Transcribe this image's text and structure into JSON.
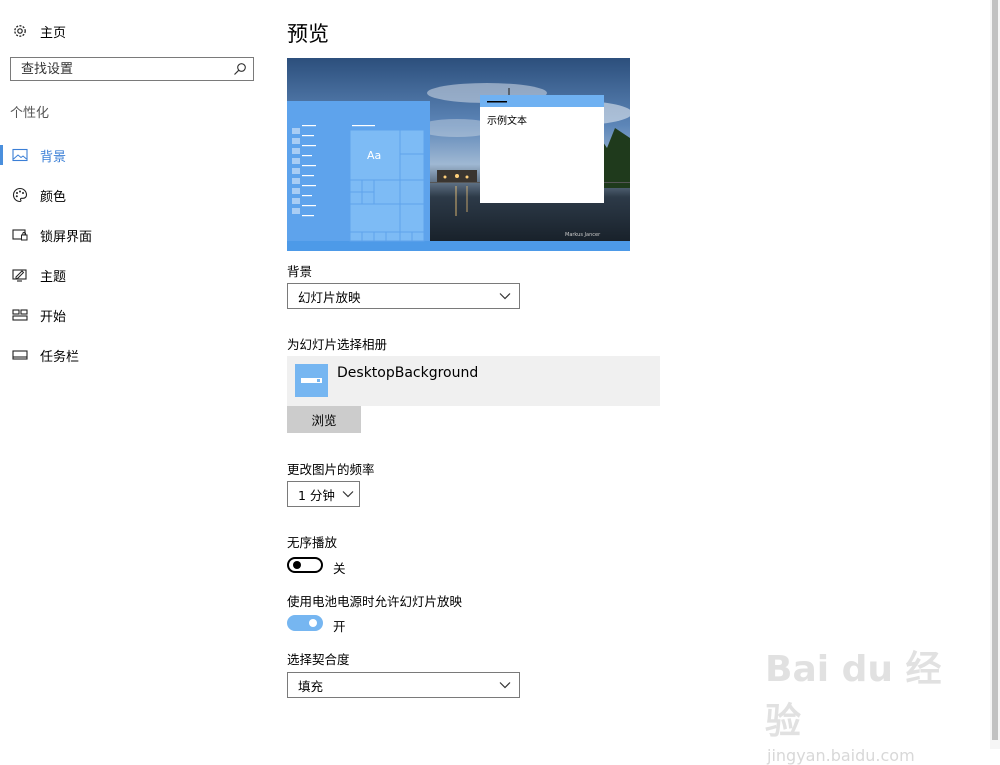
{
  "sidebar": {
    "home_label": "主页",
    "search_placeholder": "查找设置",
    "section_title": "个性化",
    "items": [
      {
        "label": "背景",
        "icon": "picture-icon",
        "selected": true
      },
      {
        "label": "颜色",
        "icon": "palette-icon",
        "selected": false
      },
      {
        "label": "锁屏界面",
        "icon": "lock-screen-icon",
        "selected": false
      },
      {
        "label": "主题",
        "icon": "theme-icon",
        "selected": false
      },
      {
        "label": "开始",
        "icon": "start-icon",
        "selected": false
      },
      {
        "label": "任务栏",
        "icon": "taskbar-icon",
        "selected": false
      }
    ]
  },
  "main": {
    "title": "预览",
    "preview": {
      "sample_text": "示例文本",
      "tile_text": "Aa"
    },
    "background": {
      "label": "背景",
      "value": "幻灯片放映"
    },
    "album": {
      "label": "为幻灯片选择相册",
      "name": "DesktopBackground",
      "browse_label": "浏览"
    },
    "frequency": {
      "label": "更改图片的频率",
      "value": "1 分钟"
    },
    "shuffle": {
      "label": "无序播放",
      "state": "关",
      "on": false
    },
    "battery": {
      "label": "使用电池电源时允许幻灯片放映",
      "state": "开",
      "on": true
    },
    "fit": {
      "label": "选择契合度",
      "value": "填充"
    }
  },
  "watermark": {
    "logo": "Bai du 经验",
    "url": "jingyan.baidu.com"
  },
  "colors": {
    "accent": "#4a8fdd",
    "toggle_on": "#76b6f1",
    "album_bg": "#f0f0f0",
    "button_bg": "#cccccc"
  }
}
